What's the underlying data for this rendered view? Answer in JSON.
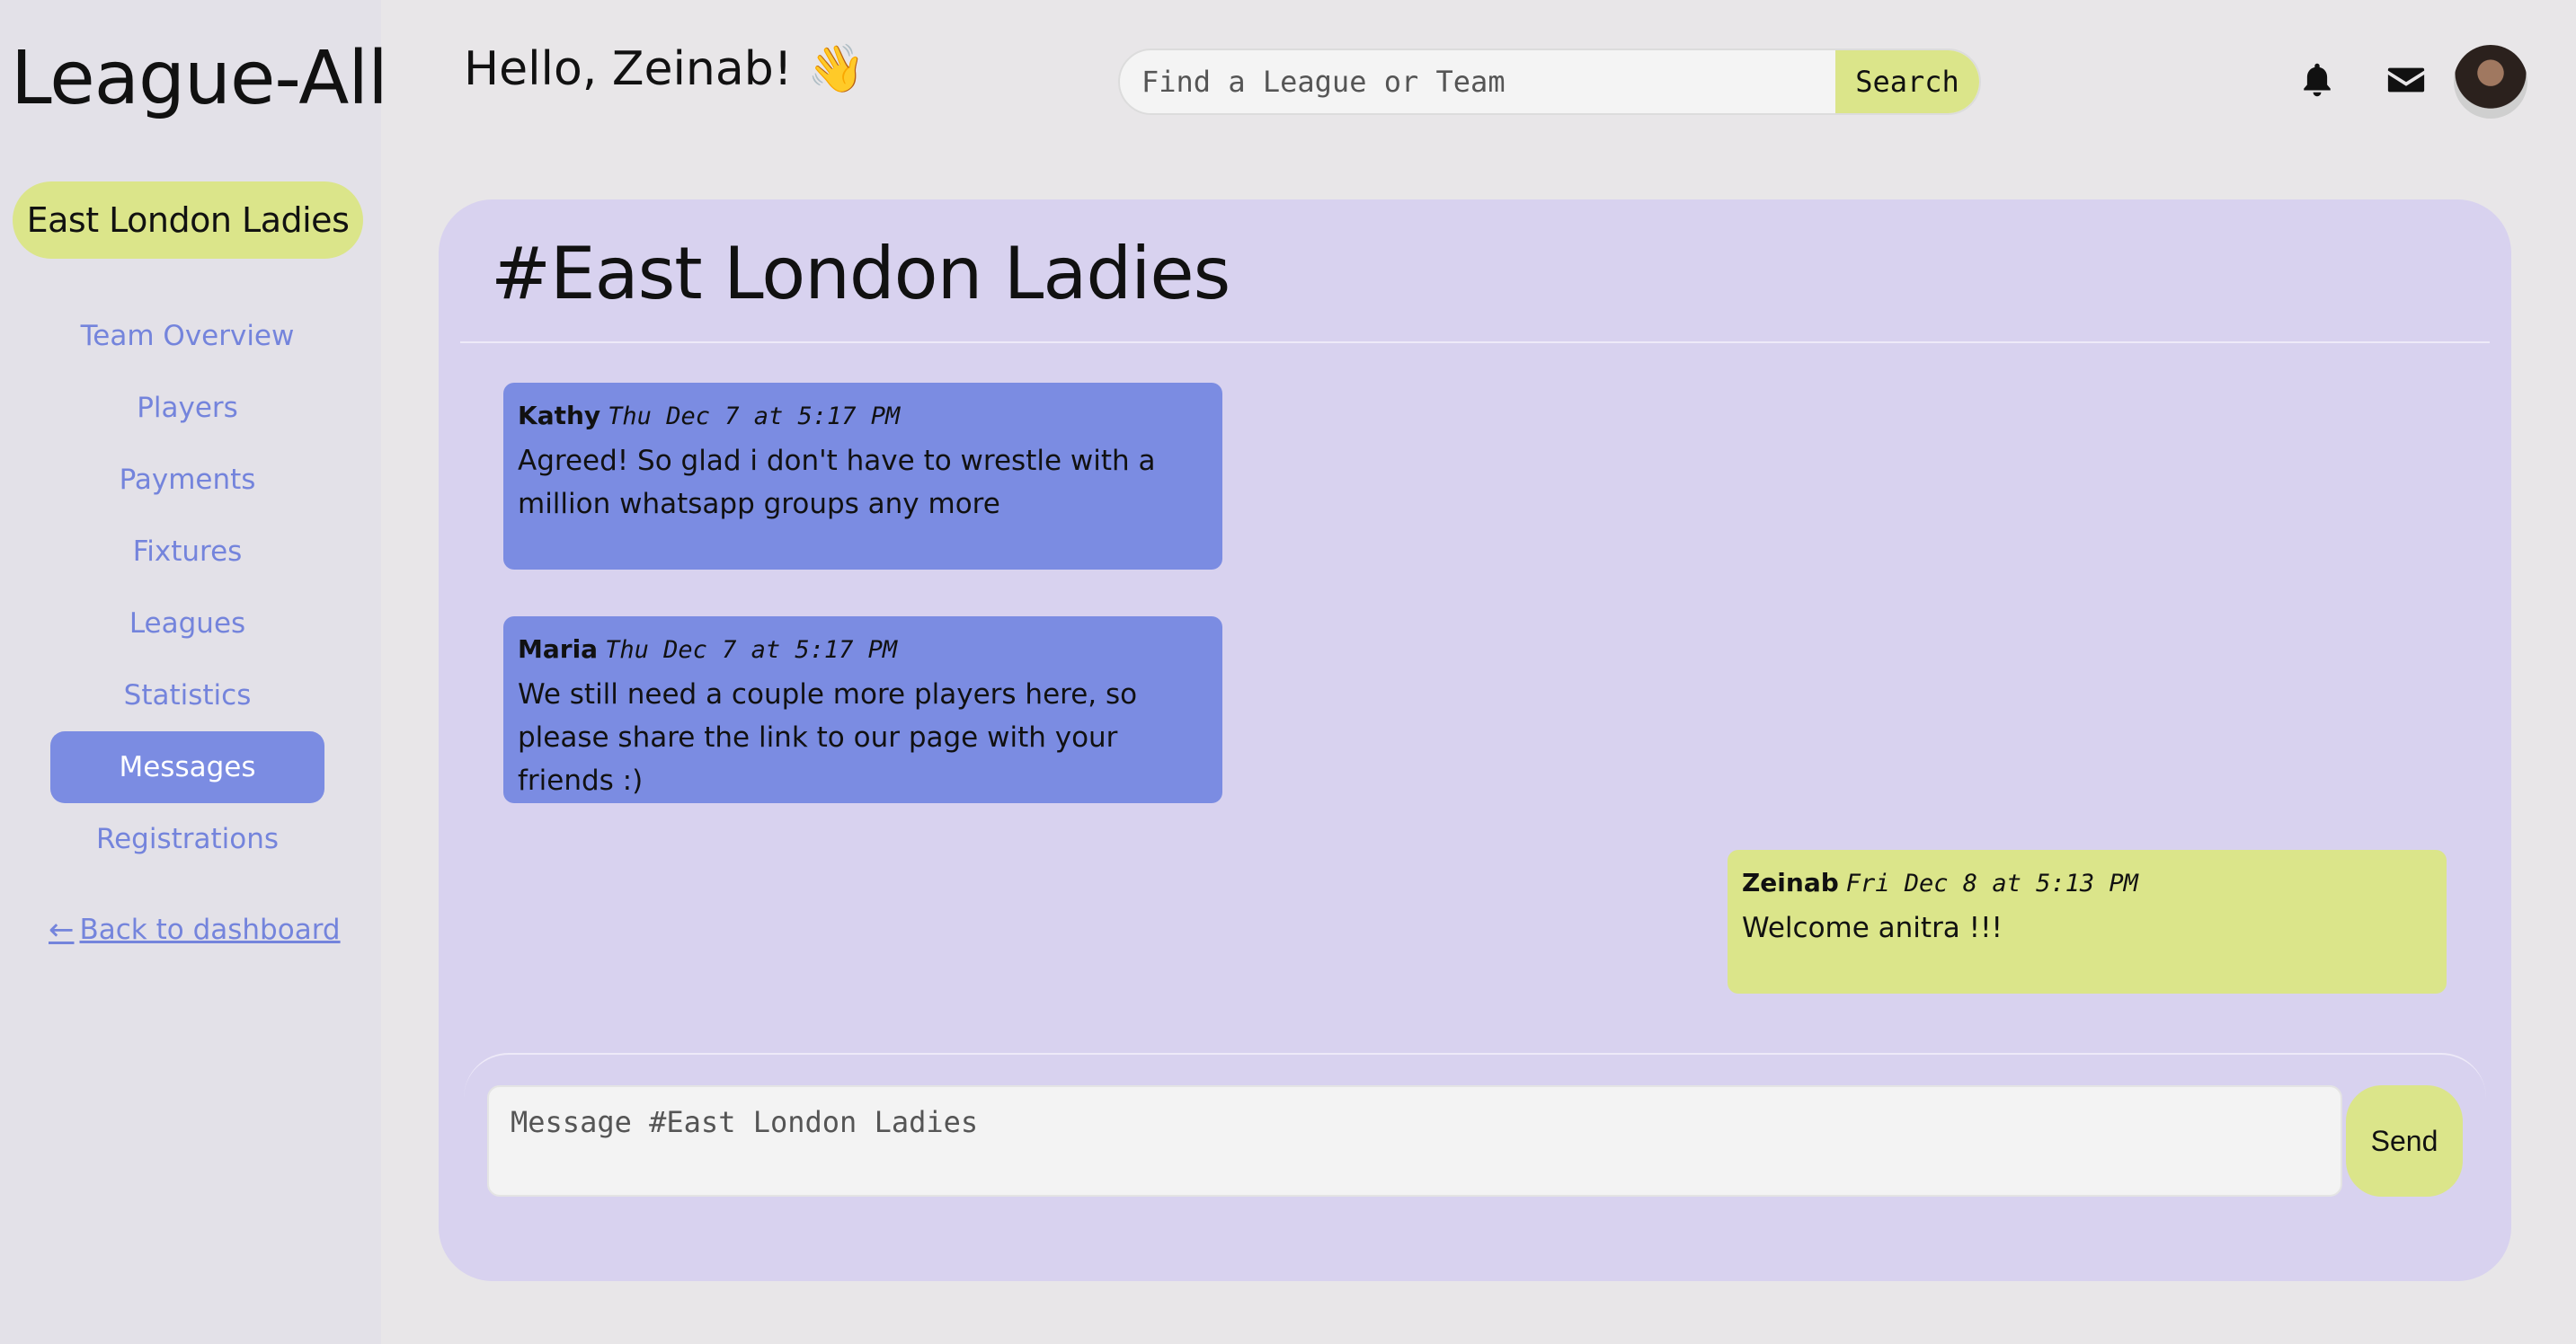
{
  "app": {
    "logo": "League-All"
  },
  "sidebar": {
    "team_name": "East London Ladies",
    "items": [
      {
        "label": "Team Overview",
        "active": false
      },
      {
        "label": "Players",
        "active": false
      },
      {
        "label": "Payments",
        "active": false
      },
      {
        "label": "Fixtures",
        "active": false
      },
      {
        "label": "Leagues",
        "active": false
      },
      {
        "label": "Statistics",
        "active": false
      },
      {
        "label": "Messages",
        "active": true
      },
      {
        "label": "Registrations",
        "active": false
      }
    ],
    "back_arrow": "←",
    "back_label": " Back to dashboard"
  },
  "header": {
    "greeting": "Hello, Zeinab! 👋",
    "search_placeholder": "Find a League or Team",
    "search_button": "Search",
    "icons": [
      "bell-icon",
      "mail-icon"
    ]
  },
  "chat": {
    "title": "#East London Ladies",
    "messages": [
      {
        "author": "Kathy",
        "time": "Thu Dec 7 at 5:17 PM",
        "text": "Agreed! So glad i don't have to wrestle with a million whatsapp groups any more",
        "mine": false
      },
      {
        "author": "Maria",
        "time": "Thu Dec 7 at 5:17 PM",
        "text": "We still need a couple more players here, so please share the link to our page with your friends :)",
        "mine": false
      },
      {
        "author": "Zeinab",
        "time": "Fri Dec 8 at 5:13 PM",
        "text": "Welcome anitra !!!",
        "mine": true
      }
    ],
    "input_placeholder": "Message #East London Ladies",
    "send_label": "Send"
  },
  "colors": {
    "accent_yellow": "#dbe58a",
    "accent_blue": "#7b8ce2",
    "panel": "#d8d2ef"
  }
}
